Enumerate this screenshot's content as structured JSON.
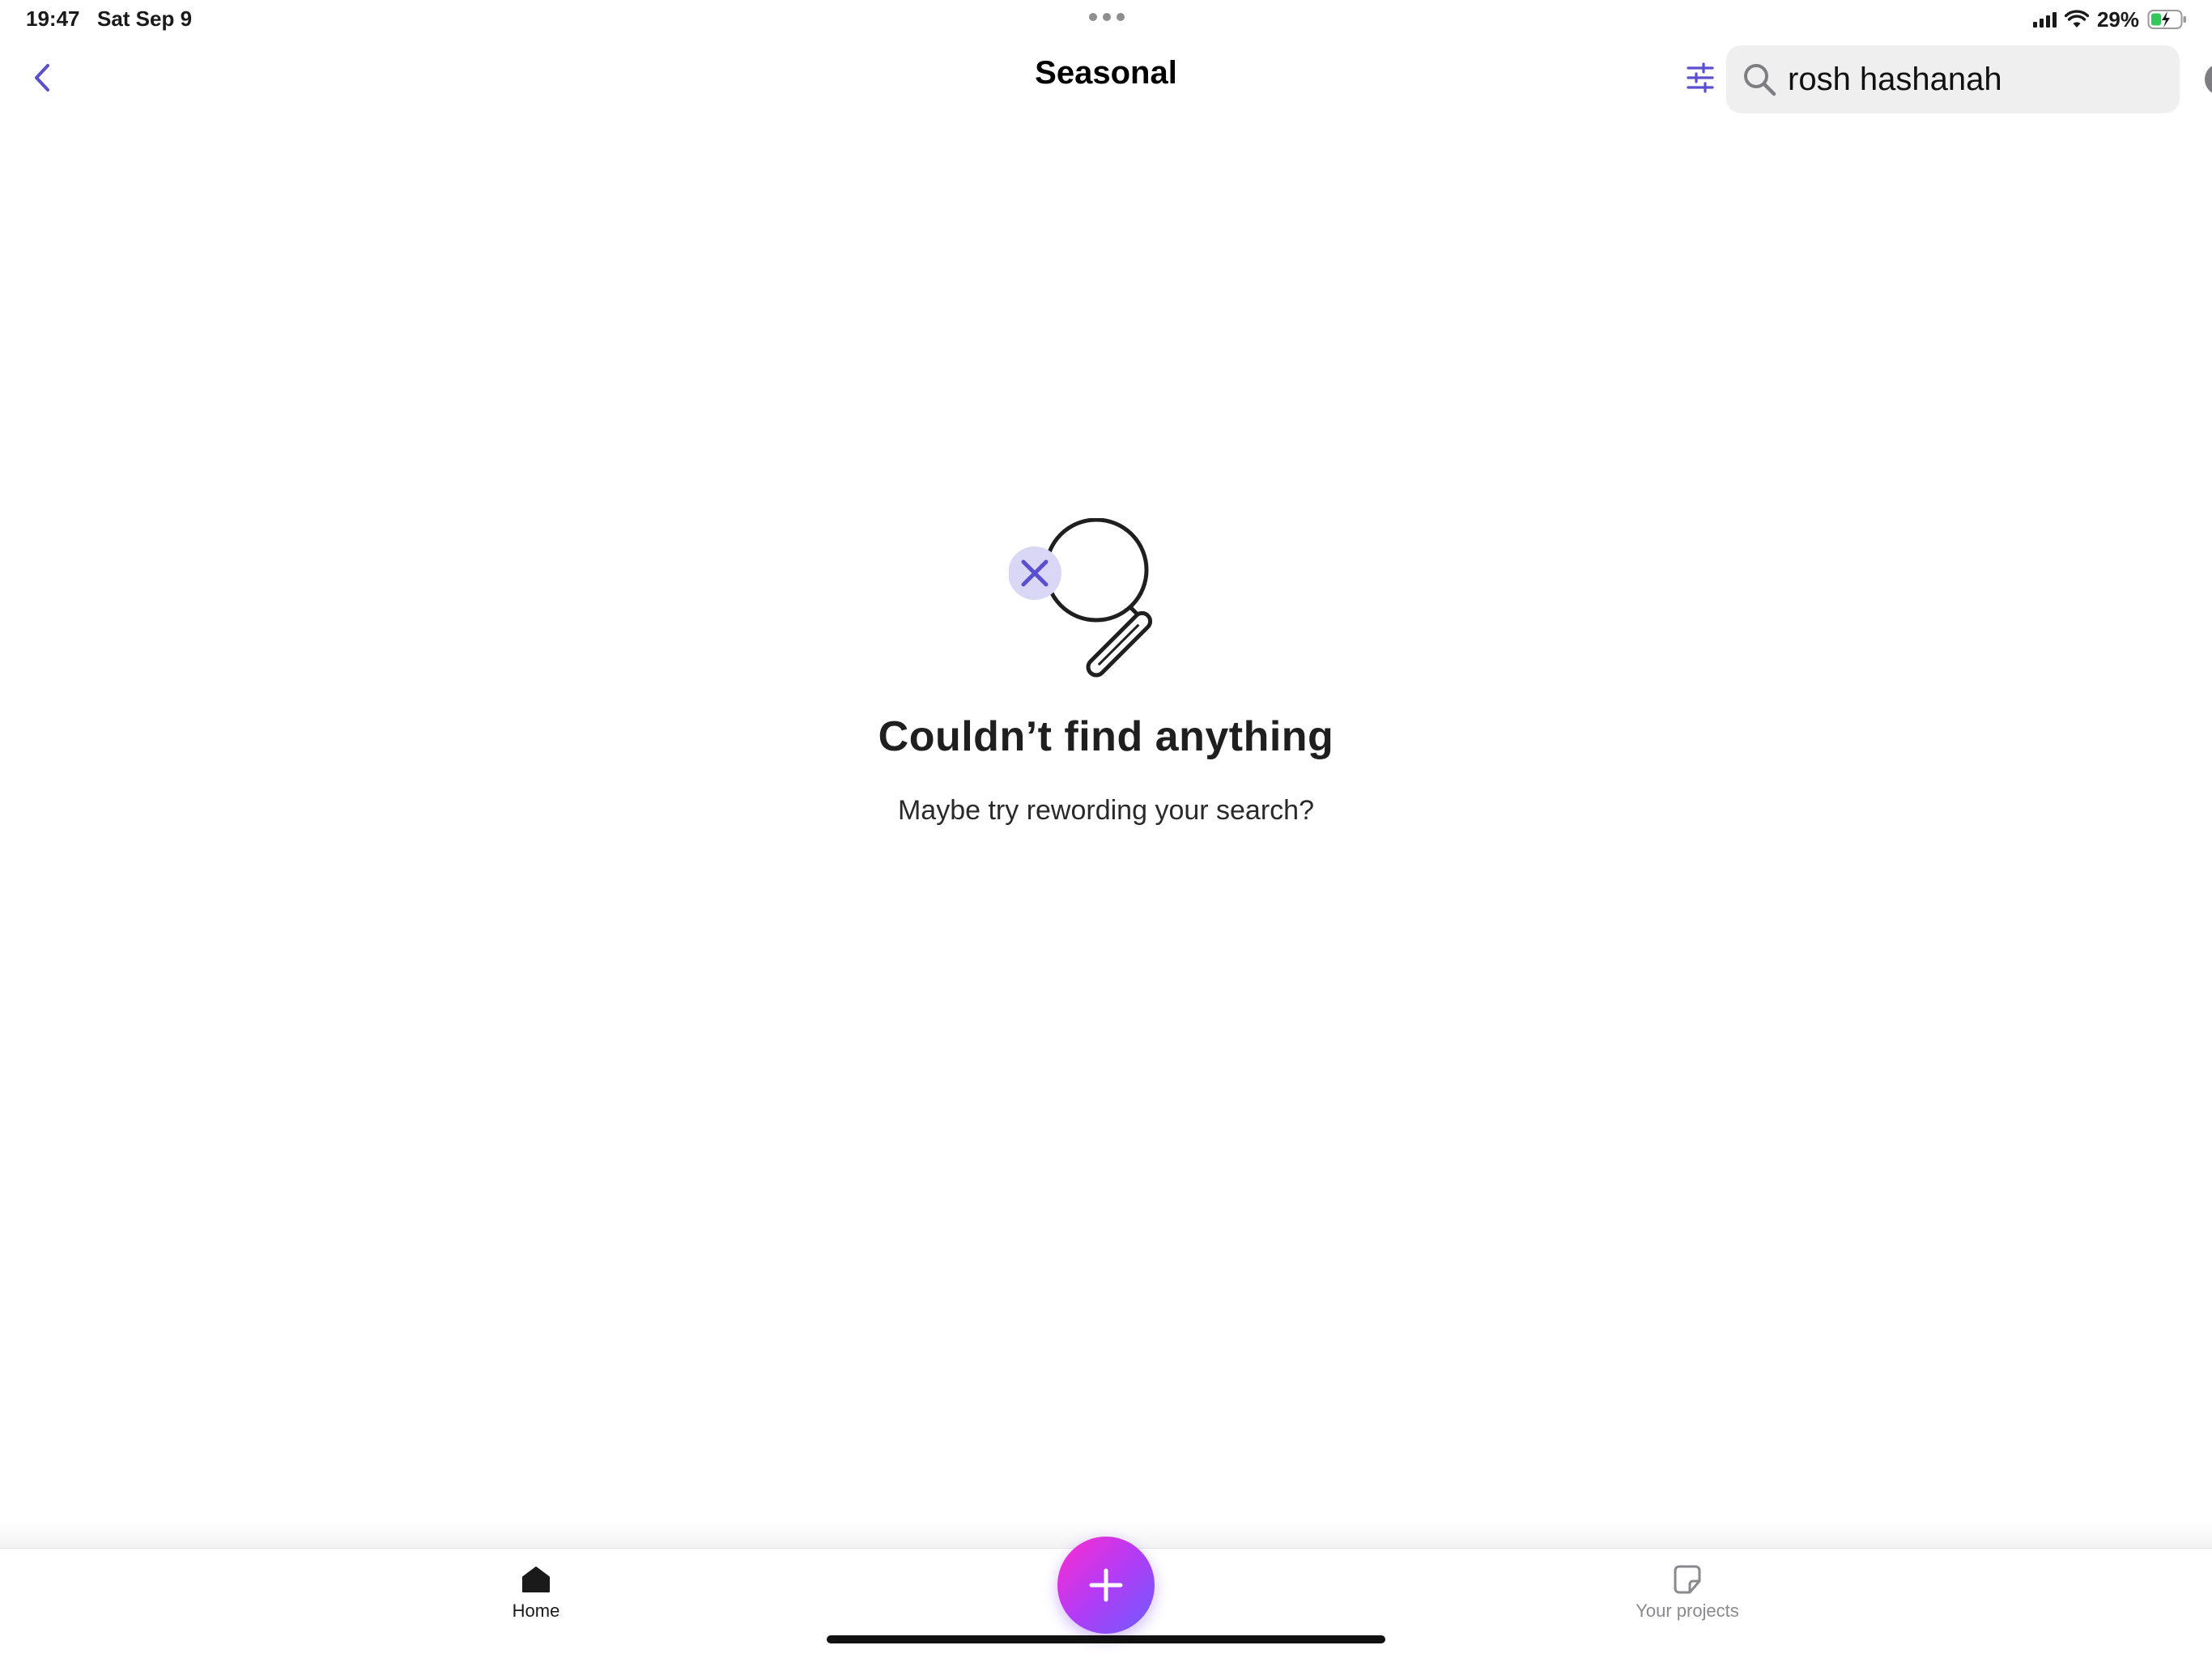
{
  "status_bar": {
    "time": "19:47",
    "date": "Sat Sep 9",
    "battery_percent": "29%",
    "battery_charging": true,
    "icons": [
      "signal-icon",
      "wifi-icon",
      "battery-icon"
    ]
  },
  "nav": {
    "back_icon": "chevron-left-icon",
    "title": "Seasonal",
    "filter_icon": "sliders-icon"
  },
  "search": {
    "value": "rosh hashanah",
    "icon": "search-icon",
    "clear_icon": "clear-icon"
  },
  "empty_state": {
    "illustration": "magnifier-x-icon",
    "title": "Couldn’t find anything",
    "subtitle": "Maybe try rewording your search?"
  },
  "tab_bar": {
    "home_label": "Home",
    "projects_label": "Your projects",
    "create_icon": "plus-icon",
    "active_tab": "Home"
  },
  "colors": {
    "accent": "#5a4fcf",
    "create_gradient_start": "#ff2bd0",
    "create_gradient_end": "#6c5cff",
    "search_background": "#efeff0"
  }
}
